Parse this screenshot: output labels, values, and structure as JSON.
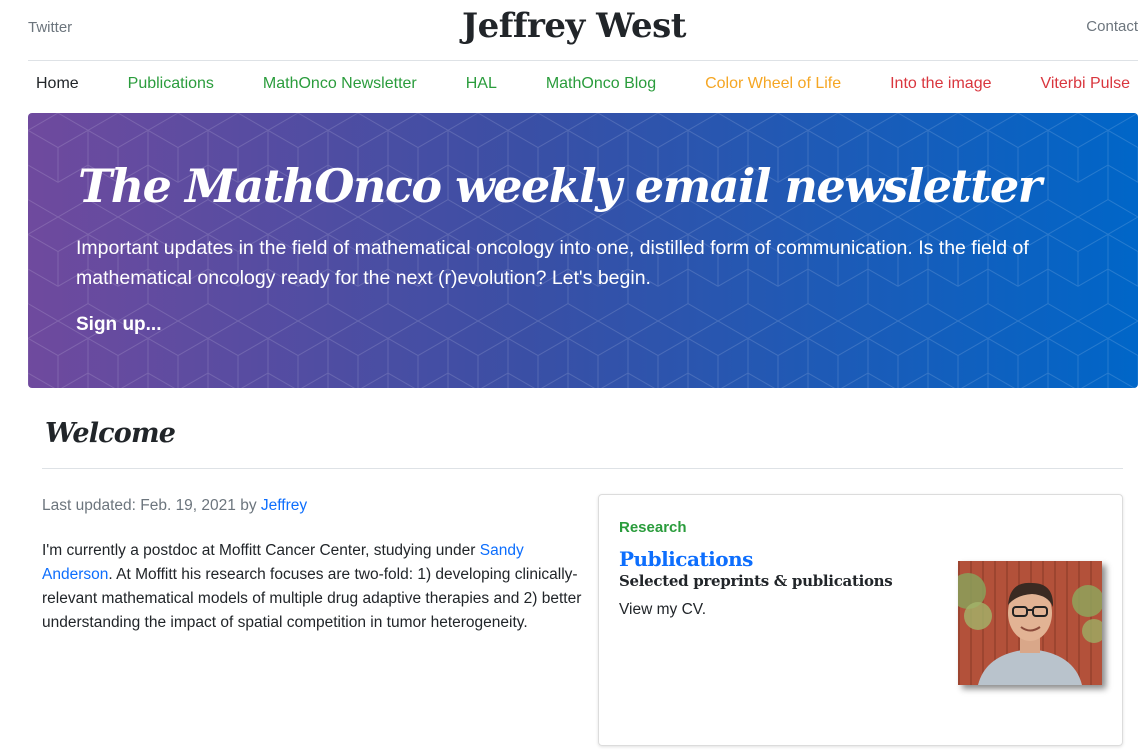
{
  "header": {
    "twitter_label": "Twitter",
    "site_title": "Jeffrey West",
    "contact_label": "Contact"
  },
  "nav": {
    "items": [
      {
        "label": "Home",
        "color": "#212529"
      },
      {
        "label": "Publications",
        "color": "#2a9c3c"
      },
      {
        "label": "MathOnco Newsletter",
        "color": "#2a9c3c"
      },
      {
        "label": "HAL",
        "color": "#2a9c3c"
      },
      {
        "label": "MathOnco Blog",
        "color": "#2a9c3c"
      },
      {
        "label": "Color Wheel of Life",
        "color": "#f5a623"
      },
      {
        "label": "Into the image",
        "color": "#d9363e"
      },
      {
        "label": "Viterbi Pulse",
        "color": "#d9363e"
      }
    ]
  },
  "jumbotron": {
    "title": "The MathOnco weekly email newsletter",
    "lead": "Important updates in the field of mathematical oncology into one, distilled form of communication. Is the field of mathematical oncology ready for the next (r)evolution? Let's begin.",
    "signup_label": "Sign up..."
  },
  "welcome": {
    "title": "Welcome",
    "last_updated_prefix": "Last updated: Feb. 19, 2021 by ",
    "author_link": "Jeffrey",
    "bio_part1": "I'm currently a postdoc at Moffitt Cancer Center, studying under ",
    "bio_link": "Sandy Anderson",
    "bio_part2": ". At Moffitt his research focuses are two-fold: 1) developing clinically-relevant mathematical models of multiple drug adaptive therapies and 2) better understanding the impact of spatial competition in tumor heterogeneity."
  },
  "research_card": {
    "category": "Research",
    "title": "Publications",
    "subtitle": "Selected preprints & publications",
    "text": "View my CV."
  },
  "colors": {
    "accent_blue": "#0d6efd",
    "accent_green": "#2a9c3c",
    "gradient_start": "#6f4a9e",
    "gradient_end": "#0066c8"
  }
}
